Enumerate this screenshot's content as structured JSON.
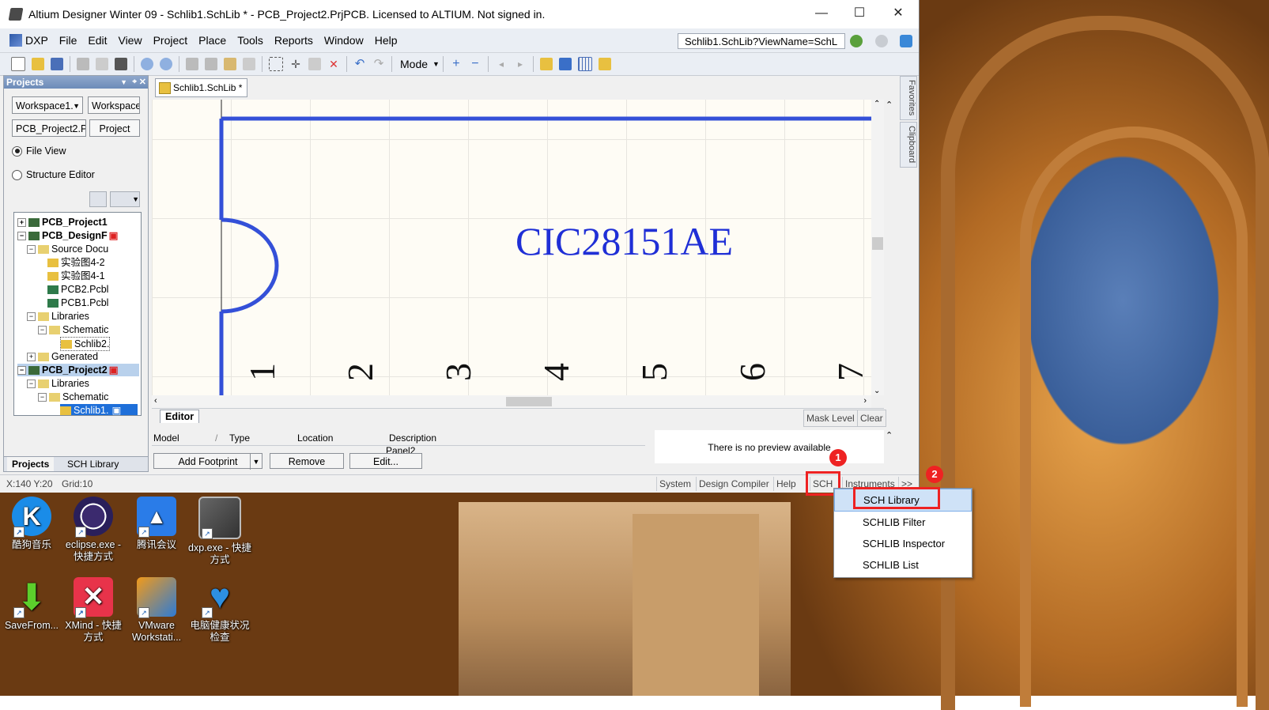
{
  "window": {
    "title": "Altium Designer Winter 09 - Schlib1.SchLib * - PCB_Project2.PrjPCB. Licensed to ALTIUM. Not signed in.",
    "minimize": "—",
    "maximize": "☐",
    "close": "✕"
  },
  "menu": {
    "dxp": "DXP",
    "items": [
      "File",
      "Edit",
      "View",
      "Project",
      "Place",
      "Tools",
      "Reports",
      "Window",
      "Help"
    ],
    "address": "Schlib1.SchLib?ViewName=SchL"
  },
  "toolbar": {
    "mode": "Mode"
  },
  "projects_panel": {
    "title": "Projects",
    "workspace_select": "Workspace1.",
    "workspace_button": "Workspace",
    "project_select": "PCB_Project2.Prj",
    "project_button": "Project",
    "file_view": "File View",
    "structure_editor": "Structure Editor",
    "tree": [
      "PCB_Project1",
      "PCB_DesignF",
      "Source Docu",
      "实验图4-2",
      "实验图4-1",
      "PCB2.Pcbl",
      "PCB1.Pcbl",
      "Libraries",
      "Schematic",
      "Schlib2.",
      "Generated",
      "PCB_Project2",
      "Libraries",
      "Schematic",
      "Schlib1."
    ],
    "tabs": [
      "Projects",
      "SCH Library"
    ]
  },
  "document": {
    "tab": "Schlib1.SchLib *",
    "component_name": "CIC28151AE",
    "pin_numbers": [
      "1",
      "2",
      "3",
      "4",
      "5",
      "6",
      "7"
    ]
  },
  "side_tabs": [
    "Favorites",
    "Clipboard"
  ],
  "editor": {
    "tab": "Editor",
    "mask_level": "Mask Level",
    "clear": "Clear",
    "columns": [
      "Model",
      "/",
      "Type",
      "Location",
      "Description"
    ],
    "partial_row": "Panel2",
    "preview": "There is no preview available",
    "add_footprint": "Add Footprint",
    "remove": "Remove",
    "edit": "Edit..."
  },
  "status": {
    "coords": "X:140 Y:20",
    "grid": "Grid:10",
    "buttons": [
      "System",
      "Design Compiler",
      "Help",
      "SCH",
      "Instruments",
      ">>"
    ]
  },
  "popup_menu": [
    "SCH Library",
    "SCHLIB Filter",
    "SCHLIB Inspector",
    "SCHLIB List"
  ],
  "badges": [
    "1",
    "2"
  ],
  "desktop_icons": [
    {
      "label": "酷狗音乐",
      "icon": "kugou-icon"
    },
    {
      "label": "eclipse.exe - 快捷方式",
      "icon": "eclipse-icon"
    },
    {
      "label": "腾讯会议",
      "icon": "tencent-meeting-icon"
    },
    {
      "label": "dxp.exe - 快捷方式",
      "icon": "dxp-icon"
    },
    {
      "label": "SaveFrom...",
      "icon": "savefrom-icon"
    },
    {
      "label": "XMind - 快捷方式",
      "icon": "xmind-icon"
    },
    {
      "label": "VMware Workstati...",
      "icon": "vmware-icon"
    },
    {
      "label": "电脑健康状况检查",
      "icon": "health-check-icon"
    }
  ],
  "colors": {
    "pin_blue": "#1f3fd6",
    "highlight_red": "#e22222",
    "selection_blue": "#1e6fd9"
  }
}
